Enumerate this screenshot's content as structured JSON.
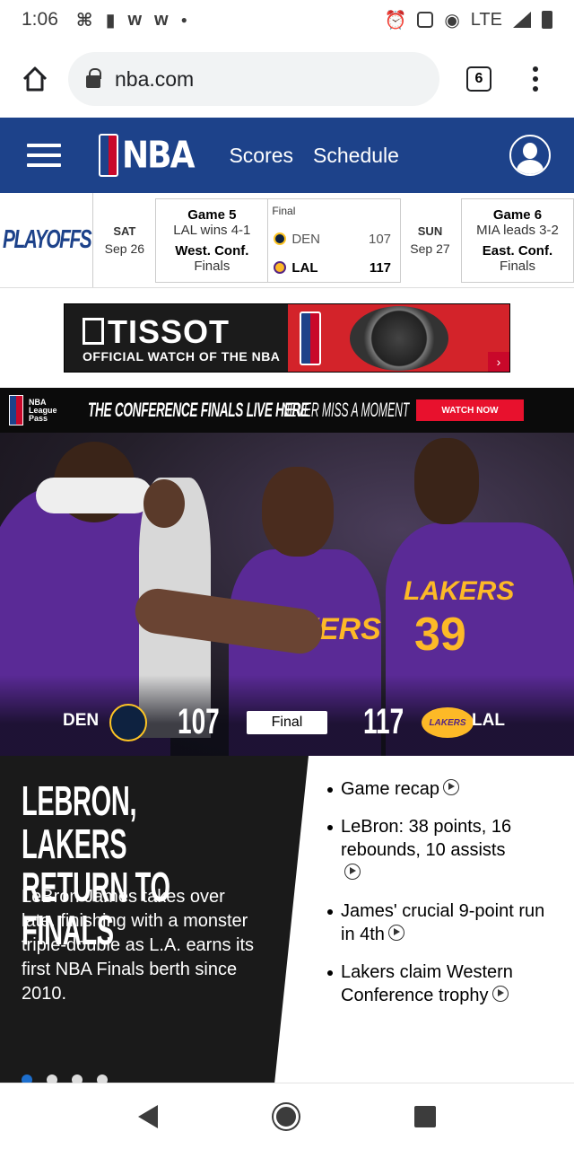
{
  "status_bar": {
    "time": "1:06",
    "network": "LTE",
    "notification_icons": [
      "slack-like-icon",
      "nba-icon",
      "w-icon",
      "w-icon",
      "dot-icon"
    ]
  },
  "browser": {
    "url": "nba.com",
    "tab_count": "6"
  },
  "nba_header": {
    "logo_text": "NBA",
    "nav": [
      "Scores",
      "Schedule"
    ]
  },
  "scores_strip": {
    "playoffs_label": "PLAYOFFS",
    "day1": {
      "dow": "SAT",
      "date": "Sep 26"
    },
    "game1": {
      "title": "Game 5",
      "series": "LAL wins 4-1",
      "conf_line1": "West. Conf.",
      "conf_line2": "Finals"
    },
    "score": {
      "status": "Final",
      "team1": "DEN",
      "team1_score": "107",
      "team2": "LAL",
      "team2_score": "117"
    },
    "day2": {
      "dow": "SUN",
      "date": "Sep 27"
    },
    "game2": {
      "title": "Game 6",
      "series": "MIA leads 3-2",
      "conf_line1": "East. Conf.",
      "conf_line2": "Finals"
    }
  },
  "ad": {
    "brand": "TISSOT",
    "tagline": "OFFICIAL WATCH OF THE NBA",
    "arrow": "›"
  },
  "league_pass_banner": {
    "logo_text": "NBA League Pass",
    "headline": "THE CONFERENCE FINALS LIVE HERE",
    "tagline": "NEVER MISS A MOMENT",
    "cta": "WATCH NOW"
  },
  "hero": {
    "team1": "DEN",
    "team1_score": "107",
    "status": "Final",
    "team2_score": "117",
    "team2": "LAL",
    "jersey_text": "LAKERS",
    "jersey_number": "39",
    "logo_text": "LAKERS"
  },
  "article": {
    "headline": "LEBRON, LAKERS RETURN TO FINALS",
    "summary": "LeBron James takes over late, finishing with a monster triple-double as L.A. earns its first NBA Finals berth since 2010.",
    "links": [
      "Game recap",
      "LeBron: 38 points, 16 rebounds, 10 assists",
      "James' crucial 9-point run in 4th",
      "Lakers claim Western Conference trophy"
    ],
    "carousel_count": 4,
    "carousel_active": 1
  },
  "colors": {
    "nba_blue": "#1d428a",
    "nba_red": "#c9082a",
    "lakers_purple": "#552583",
    "lakers_gold": "#fdb927"
  }
}
